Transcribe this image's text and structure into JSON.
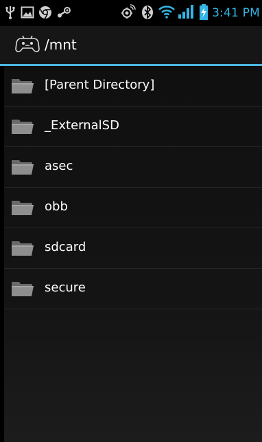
{
  "status_bar": {
    "time": "3:41 PM",
    "icons": [
      "usb-icon",
      "image-notification-icon",
      "chrome-icon",
      "steam-icon",
      "gps-icon",
      "bluetooth-icon",
      "wifi-icon",
      "signal-icon",
      "battery-charging-icon"
    ],
    "accent_color": "#33b5e5"
  },
  "header": {
    "app_icon": "gamepad-icon",
    "path": "/mnt"
  },
  "file_list": [
    {
      "label": "[Parent Directory]",
      "icon": "folder-icon"
    },
    {
      "label": "_ExternalSD",
      "icon": "folder-icon"
    },
    {
      "label": "asec",
      "icon": "folder-icon"
    },
    {
      "label": "obb",
      "icon": "folder-icon"
    },
    {
      "label": "sdcard",
      "icon": "folder-icon"
    },
    {
      "label": "secure",
      "icon": "folder-icon"
    }
  ]
}
